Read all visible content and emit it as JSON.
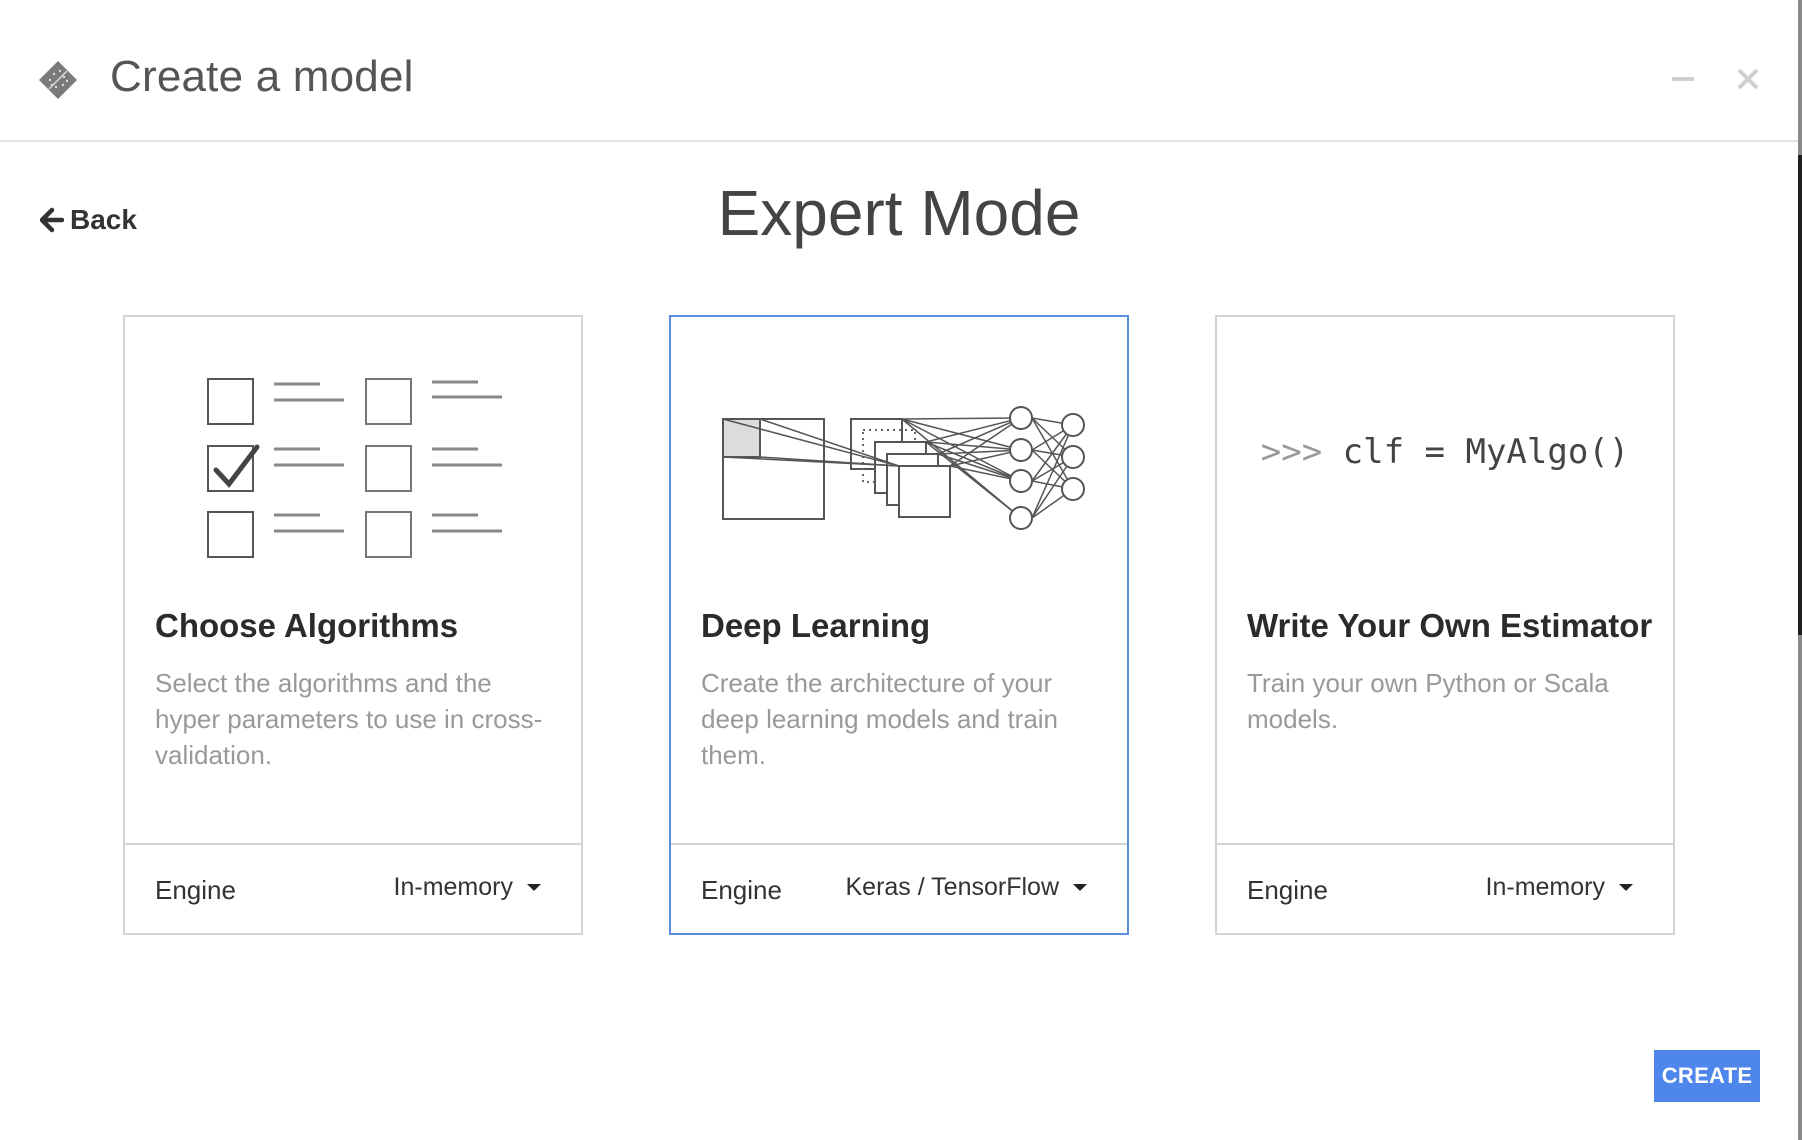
{
  "window": {
    "title": "Create a model",
    "logo_icon": "dataiku-bird-icon",
    "minimize_icon": "minimize-icon",
    "close_icon": "close-icon"
  },
  "nav": {
    "back_label": "Back",
    "back_icon": "arrow-left-icon"
  },
  "page": {
    "heading": "Expert Mode"
  },
  "cards": [
    {
      "title": "Choose Algorithms",
      "description": "Select the algorithms and the hyper parameters to use in cross-validation.",
      "illustration": "checklist-illustration",
      "engine_label": "Engine",
      "engine_value": "In-memory",
      "selected": false
    },
    {
      "title": "Deep Learning",
      "description": "Create the architecture of your deep learning models and train them.",
      "illustration": "neural-network-illustration",
      "engine_label": "Engine",
      "engine_value": "Keras / TensorFlow",
      "selected": true
    },
    {
      "title": "Write Your Own Estimator",
      "description": "Train your own Python or Scala models.",
      "illustration": "code-snippet-illustration",
      "code_prompt": ">>>",
      "code_text": "clf = MyAlgo()",
      "engine_label": "Engine",
      "engine_value": "In-memory",
      "selected": false
    }
  ],
  "actions": {
    "create_label": "CREATE"
  },
  "colors": {
    "accent": "#4f86ec",
    "selected_border": "#5b8de0",
    "card_border": "#d4d4d4",
    "muted_text": "#999999"
  }
}
